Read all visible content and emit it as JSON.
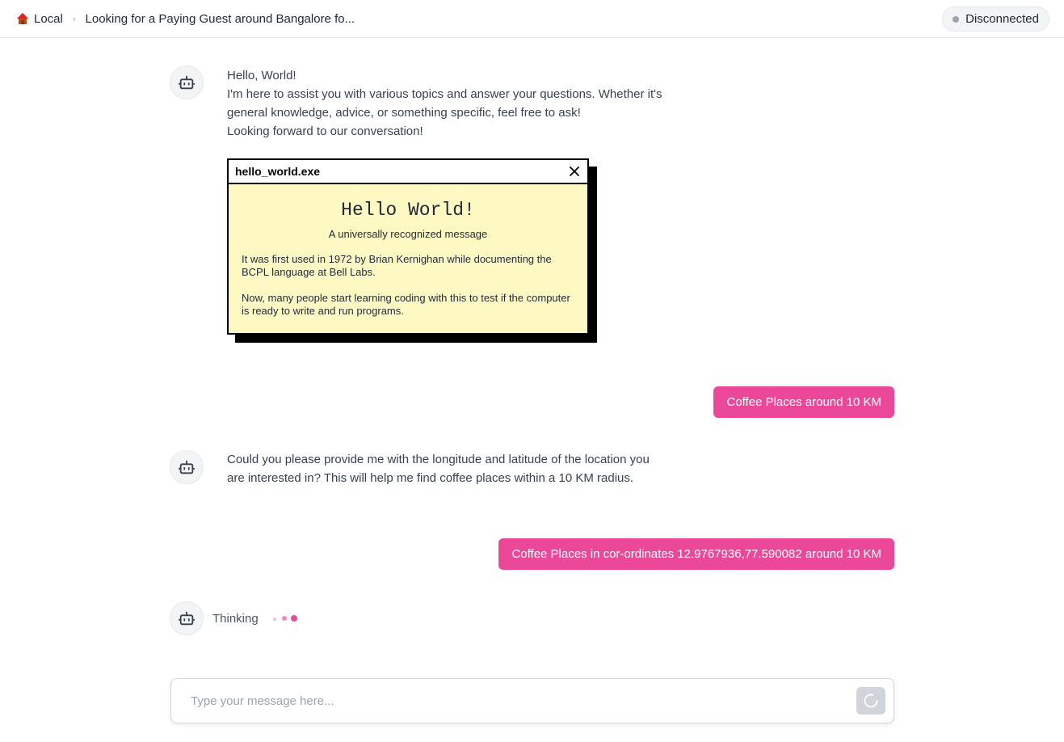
{
  "header": {
    "breadcrumb_root": "Local",
    "breadcrumb_current": "Looking for a Paying Guest around Bangalore fo...",
    "status_label": "Disconnected"
  },
  "messages": {
    "bot_1": {
      "line1": "Hello, World!",
      "line2": "I'm here to assist you with various topics and answer your questions. Whether it's general knowledge, advice, or something specific, feel free to ask!",
      "line3": "Looking forward to our conversation!"
    },
    "window": {
      "title": "hello_world.exe",
      "heading": "Hello World!",
      "subheading": "A universally recognized message",
      "para1": "It was first used in 1972 by Brian Kernighan while documenting the BCPL language at Bell Labs.",
      "para2": "Now, many people start learning coding with this to test if the computer is ready to write and run programs."
    },
    "user_1": "Coffee Places around 10 KM",
    "bot_2": "Could you please provide me with the longitude and latitude of the location you are interested in? This will help me find coffee places within a 10 KM radius.",
    "user_2": "Coffee Places in cor-ordinates 12.9767936,77.590082 around 10 KM",
    "thinking": "Thinking"
  },
  "composer": {
    "placeholder": "Type your message here..."
  },
  "colors": {
    "accent": "#ec4899",
    "window_bg": "#fef9c3",
    "status_dot": "#9ca3af"
  },
  "icons": {
    "home": "house-emoji-icon",
    "bot": "robot-icon",
    "close": "close-icon",
    "spinner": "spinner-icon"
  }
}
